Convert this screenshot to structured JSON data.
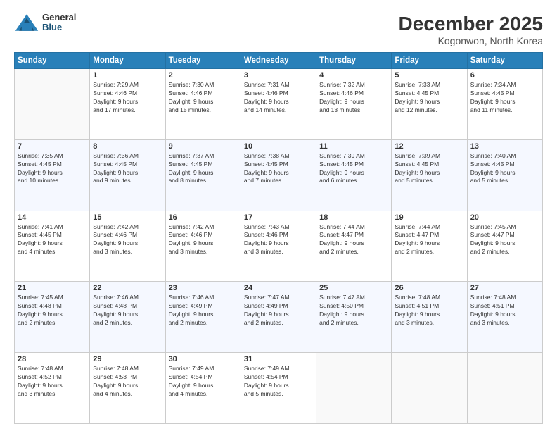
{
  "logo": {
    "general": "General",
    "blue": "Blue"
  },
  "header": {
    "month": "December 2025",
    "location": "Kogonwon, North Korea"
  },
  "weekdays": [
    "Sunday",
    "Monday",
    "Tuesday",
    "Wednesday",
    "Thursday",
    "Friday",
    "Saturday"
  ],
  "weeks": [
    [
      {
        "day": "",
        "info": ""
      },
      {
        "day": "1",
        "info": "Sunrise: 7:29 AM\nSunset: 4:46 PM\nDaylight: 9 hours\nand 17 minutes."
      },
      {
        "day": "2",
        "info": "Sunrise: 7:30 AM\nSunset: 4:46 PM\nDaylight: 9 hours\nand 15 minutes."
      },
      {
        "day": "3",
        "info": "Sunrise: 7:31 AM\nSunset: 4:46 PM\nDaylight: 9 hours\nand 14 minutes."
      },
      {
        "day": "4",
        "info": "Sunrise: 7:32 AM\nSunset: 4:46 PM\nDaylight: 9 hours\nand 13 minutes."
      },
      {
        "day": "5",
        "info": "Sunrise: 7:33 AM\nSunset: 4:45 PM\nDaylight: 9 hours\nand 12 minutes."
      },
      {
        "day": "6",
        "info": "Sunrise: 7:34 AM\nSunset: 4:45 PM\nDaylight: 9 hours\nand 11 minutes."
      }
    ],
    [
      {
        "day": "7",
        "info": "Sunrise: 7:35 AM\nSunset: 4:45 PM\nDaylight: 9 hours\nand 10 minutes."
      },
      {
        "day": "8",
        "info": "Sunrise: 7:36 AM\nSunset: 4:45 PM\nDaylight: 9 hours\nand 9 minutes."
      },
      {
        "day": "9",
        "info": "Sunrise: 7:37 AM\nSunset: 4:45 PM\nDaylight: 9 hours\nand 8 minutes."
      },
      {
        "day": "10",
        "info": "Sunrise: 7:38 AM\nSunset: 4:45 PM\nDaylight: 9 hours\nand 7 minutes."
      },
      {
        "day": "11",
        "info": "Sunrise: 7:39 AM\nSunset: 4:45 PM\nDaylight: 9 hours\nand 6 minutes."
      },
      {
        "day": "12",
        "info": "Sunrise: 7:39 AM\nSunset: 4:45 PM\nDaylight: 9 hours\nand 5 minutes."
      },
      {
        "day": "13",
        "info": "Sunrise: 7:40 AM\nSunset: 4:45 PM\nDaylight: 9 hours\nand 5 minutes."
      }
    ],
    [
      {
        "day": "14",
        "info": "Sunrise: 7:41 AM\nSunset: 4:45 PM\nDaylight: 9 hours\nand 4 minutes."
      },
      {
        "day": "15",
        "info": "Sunrise: 7:42 AM\nSunset: 4:46 PM\nDaylight: 9 hours\nand 3 minutes."
      },
      {
        "day": "16",
        "info": "Sunrise: 7:42 AM\nSunset: 4:46 PM\nDaylight: 9 hours\nand 3 minutes."
      },
      {
        "day": "17",
        "info": "Sunrise: 7:43 AM\nSunset: 4:46 PM\nDaylight: 9 hours\nand 3 minutes."
      },
      {
        "day": "18",
        "info": "Sunrise: 7:44 AM\nSunset: 4:47 PM\nDaylight: 9 hours\nand 2 minutes."
      },
      {
        "day": "19",
        "info": "Sunrise: 7:44 AM\nSunset: 4:47 PM\nDaylight: 9 hours\nand 2 minutes."
      },
      {
        "day": "20",
        "info": "Sunrise: 7:45 AM\nSunset: 4:47 PM\nDaylight: 9 hours\nand 2 minutes."
      }
    ],
    [
      {
        "day": "21",
        "info": "Sunrise: 7:45 AM\nSunset: 4:48 PM\nDaylight: 9 hours\nand 2 minutes."
      },
      {
        "day": "22",
        "info": "Sunrise: 7:46 AM\nSunset: 4:48 PM\nDaylight: 9 hours\nand 2 minutes."
      },
      {
        "day": "23",
        "info": "Sunrise: 7:46 AM\nSunset: 4:49 PM\nDaylight: 9 hours\nand 2 minutes."
      },
      {
        "day": "24",
        "info": "Sunrise: 7:47 AM\nSunset: 4:49 PM\nDaylight: 9 hours\nand 2 minutes."
      },
      {
        "day": "25",
        "info": "Sunrise: 7:47 AM\nSunset: 4:50 PM\nDaylight: 9 hours\nand 2 minutes."
      },
      {
        "day": "26",
        "info": "Sunrise: 7:48 AM\nSunset: 4:51 PM\nDaylight: 9 hours\nand 3 minutes."
      },
      {
        "day": "27",
        "info": "Sunrise: 7:48 AM\nSunset: 4:51 PM\nDaylight: 9 hours\nand 3 minutes."
      }
    ],
    [
      {
        "day": "28",
        "info": "Sunrise: 7:48 AM\nSunset: 4:52 PM\nDaylight: 9 hours\nand 3 minutes."
      },
      {
        "day": "29",
        "info": "Sunrise: 7:48 AM\nSunset: 4:53 PM\nDaylight: 9 hours\nand 4 minutes."
      },
      {
        "day": "30",
        "info": "Sunrise: 7:49 AM\nSunset: 4:54 PM\nDaylight: 9 hours\nand 4 minutes."
      },
      {
        "day": "31",
        "info": "Sunrise: 7:49 AM\nSunset: 4:54 PM\nDaylight: 9 hours\nand 5 minutes."
      },
      {
        "day": "",
        "info": ""
      },
      {
        "day": "",
        "info": ""
      },
      {
        "day": "",
        "info": ""
      }
    ]
  ]
}
